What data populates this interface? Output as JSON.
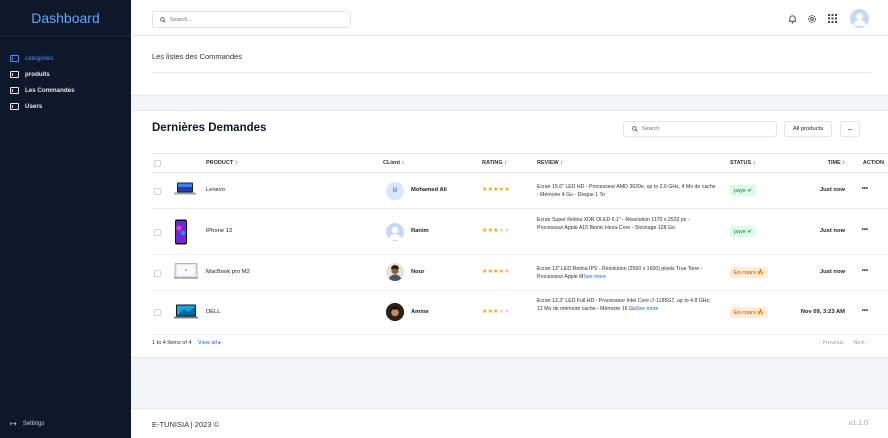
{
  "sidebar": {
    "brand": "Dashboard",
    "items": [
      {
        "label": "categories",
        "active": true
      },
      {
        "label": "produits",
        "active": false
      },
      {
        "label": "Les Commandes",
        "active": false
      },
      {
        "label": "Users",
        "active": false
      }
    ],
    "settings_label": "Settings"
  },
  "topbar": {
    "search_placeholder": "Search..."
  },
  "page": {
    "title": "Les listes des Commandes"
  },
  "orders": {
    "title": "Dernières Demandes",
    "search_placeholder": "Search",
    "all_products_label": "All products",
    "more_label": "...",
    "columns": {
      "product": "PRODUCT ↕",
      "client": "CLient ↕",
      "rating": "RATING ↕",
      "review": "REVIEW ↕",
      "status": "STATUS ↕",
      "time": "TIME ↕",
      "action": "ACTION"
    },
    "rows": [
      {
        "product": "Lenevo",
        "client": "Mohamed Ali",
        "client_initial": "M",
        "rating": 5,
        "review": "Ecran 15.6\" LED HD - Processeur AMD 3020e, up to 2.6 GHz, 4 Mo de cache - Mémoire 4 Go - Disque 1 To",
        "see_more": "",
        "status": "paye ✔",
        "time": "Just now",
        "action": "•••"
      },
      {
        "product": "iPhone 13",
        "client": "Ranim",
        "client_initial": "",
        "rating": 3,
        "review": "Ecran Super Retina XDR OLED 6.1\" - Résolution 1170 x 2532 px - Processeur Apple A15 Bionic Hexa-Core - Stockage 128 Go",
        "see_more": "",
        "status": "paye ✔",
        "time": "Just now",
        "action": "•••"
      },
      {
        "product": "MacBook pro M2",
        "client": "Nour",
        "client_initial": "",
        "rating": 4.5,
        "review": "Ecran 13\" LED Retina IPS - Résolution (2560 x 1600) pixels True Tone - Processeur Apple M",
        "see_more": "See more",
        "status": "En cours 🔥",
        "time": "Just now",
        "action": "•••"
      },
      {
        "product": "DELL",
        "client": "Amine",
        "client_initial": "",
        "rating": 3,
        "review": "Ecran 13.3\" LED Full HD - Processeur Intel Core i7-1185G7, up to 4.8 GHz, 12 Mo de mémoire cache - Mémoire 16 Go",
        "see_more": "See more",
        "status": "En cours 🔥",
        "time": "Nov 09, 3:23 AM",
        "action": "•••"
      }
    ],
    "footer_count": "1 to 4 Items of 4",
    "view_all": "View all ▸",
    "prev": "‹ Previous",
    "next": "Next ›"
  },
  "footer": {
    "left": "E-TUNISIA | 2023 ©",
    "right": "v1.1.0"
  }
}
